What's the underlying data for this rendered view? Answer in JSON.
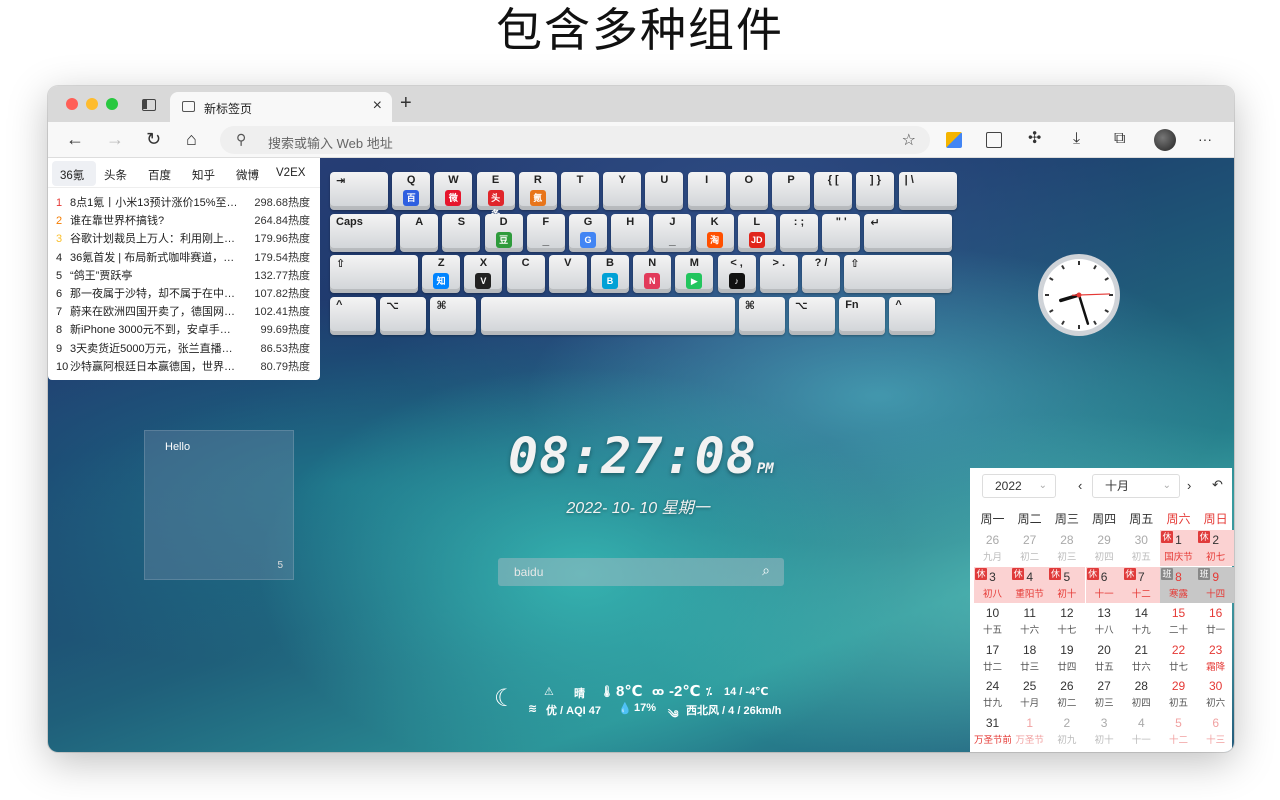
{
  "headline": "包含多种组件",
  "tab": {
    "title": "新标签页",
    "close": "×",
    "new": "+"
  },
  "toolbar": {
    "back": "←",
    "forward": "→",
    "reload": "↻",
    "home": "⌂",
    "search_placeholder": "搜索或输入 Web 地址",
    "more": "···"
  },
  "hot": {
    "tabs": [
      "36氪",
      "头条",
      "百度",
      "知乎",
      "微博",
      "V2EX"
    ],
    "active": "36氪",
    "items": [
      {
        "rank": "1",
        "title": "8点1氪丨小米13预计涨价15%至2…",
        "heat": "298.68热度"
      },
      {
        "rank": "2",
        "title": "谁在靠世界杯搞钱?",
        "heat": "264.84热度"
      },
      {
        "rank": "3",
        "title": "谷歌计划裁员上万人：利用刚上…",
        "heat": "179.96热度"
      },
      {
        "rank": "4",
        "title": "36氪首发 | 布局新式咖啡赛道，…",
        "heat": "179.54热度"
      },
      {
        "rank": "5",
        "title": "“鸽王”贾跃亭",
        "heat": "132.77热度"
      },
      {
        "rank": "6",
        "title": "那一夜属于沙特，却不属于在中…",
        "heat": "107.82热度"
      },
      {
        "rank": "7",
        "title": "蔚来在欧洲四国开卖了，德国网…",
        "heat": "102.41热度"
      },
      {
        "rank": "8",
        "title": "新iPhone 3000元不到，安卓手机…",
        "heat": "99.69热度"
      },
      {
        "rank": "9",
        "title": "3天卖货近5000万元，张兰直播间…",
        "heat": "86.53热度"
      },
      {
        "rank": "10",
        "title": "沙特赢阿根廷日本赢德国，世界杯…",
        "heat": "80.79热度"
      }
    ],
    "rank_colors": [
      "#e53935",
      "#f57c00",
      "#fbc02d"
    ]
  },
  "keyboard": {
    "rows": [
      [
        "⇥",
        "Q",
        "W",
        "E",
        "R",
        "T",
        "Y",
        "U",
        "I",
        "O",
        "P",
        "{ [",
        "] }",
        "| \\"
      ],
      [
        "Caps",
        "A",
        "S",
        "D",
        "F",
        "G",
        "H",
        "J",
        "K",
        "L",
        ": ;",
        "\" '",
        "↵"
      ],
      [
        "⇧",
        "Z",
        "X",
        "C",
        "V",
        "B",
        "N",
        "M",
        "< ,",
        "> .",
        "? /",
        "⇧"
      ],
      [
        "^",
        "⌥",
        "⌘",
        "",
        "⌘",
        "⌥",
        "Fn",
        "^"
      ]
    ],
    "icons": {
      "Q": "baidu-icon",
      "W": "weibo-icon",
      "E": "toutiao-icon",
      "R": "36kr-icon",
      "D": "douban-icon",
      "F": "underscore",
      "G": "google-icon",
      "J": "underscore",
      "K": "taobao-icon",
      "L": "jd-icon",
      "Z": "zhihu-icon",
      "X": "v2ex-icon",
      "B": "bilibili-icon",
      "N": "nn-icon",
      "M": "play-icon",
      "< ,": "tiktok-icon"
    },
    "icon_glyphs": {
      "Q": "百",
      "W": "微",
      "E": "头条",
      "R": "氪",
      "D": "豆",
      "F": "_",
      "G": "G",
      "J": "_",
      "K": "淘",
      "L": "JD",
      "Z": "知",
      "X": "V",
      "B": "B",
      "N": "N",
      "M": "▶",
      "< ,": "♪"
    },
    "icon_colors": {
      "Q": "#2f5fe0",
      "W": "#e6162d",
      "E": "#e0262b",
      "R": "#e8751a",
      "D": "#2e9b3c",
      "G": "#4285f4",
      "K": "#ff5000",
      "L": "#e1251b",
      "Z": "#0084ff",
      "X": "#222222",
      "B": "#00a1d6",
      "N": "#e23a5a",
      "M": "#22c55e",
      "< ,": "#111111"
    }
  },
  "clock": {
    "hour": 8,
    "minute": 27,
    "second": 8
  },
  "memo": {
    "text": "Hello",
    "count": "5"
  },
  "datetime": {
    "time": "08:27:08",
    "ampm": "PM",
    "date": "2022- 10- 10  星期一"
  },
  "search": {
    "value": "baidu",
    "button": "⌕"
  },
  "weather": {
    "moon": "☾",
    "warn": "⚠",
    "condition": "晴",
    "temp": "8℃",
    "feel": "-2℃",
    "range": "14 / -4℃",
    "aqi": "优 / AQI 47",
    "humidity": "17%",
    "wind": "西北风 / 4 / 26km/h"
  },
  "calendar": {
    "year": "2022",
    "month": "十月",
    "prev": "‹",
    "next": "›",
    "back": "↶",
    "weekdays": [
      "周一",
      "周二",
      "周三",
      "周四",
      "周五",
      "周六",
      "周日"
    ],
    "cells": [
      {
        "d": "26",
        "l": "九月",
        "m": "other"
      },
      {
        "d": "27",
        "l": "初二",
        "m": "other"
      },
      {
        "d": "28",
        "l": "初三",
        "m": "other"
      },
      {
        "d": "29",
        "l": "初四",
        "m": "other"
      },
      {
        "d": "30",
        "l": "初五",
        "m": "other"
      },
      {
        "d": "1",
        "l": "国庆节",
        "m": "hol",
        "b": "休"
      },
      {
        "d": "2",
        "l": "初七",
        "m": "hol",
        "b": "休"
      },
      {
        "d": "3",
        "l": "初八",
        "m": "hol",
        "b": "休"
      },
      {
        "d": "4",
        "l": "重阳节",
        "m": "hol",
        "b": "休"
      },
      {
        "d": "5",
        "l": "初十",
        "m": "hol",
        "b": "休"
      },
      {
        "d": "6",
        "l": "十一",
        "m": "hol",
        "b": "休"
      },
      {
        "d": "7",
        "l": "十二",
        "m": "hol",
        "b": "休"
      },
      {
        "d": "8",
        "l": "寒露",
        "m": "work",
        "b": "班"
      },
      {
        "d": "9",
        "l": "十四",
        "m": "work",
        "b": "班"
      },
      {
        "d": "10",
        "l": "十五",
        "m": "cur"
      },
      {
        "d": "11",
        "l": "十六",
        "m": "cur"
      },
      {
        "d": "12",
        "l": "十七",
        "m": "cur"
      },
      {
        "d": "13",
        "l": "十八",
        "m": "cur"
      },
      {
        "d": "14",
        "l": "十九",
        "m": "cur"
      },
      {
        "d": "15",
        "l": "二十",
        "m": "wk"
      },
      {
        "d": "16",
        "l": "廿一",
        "m": "wk"
      },
      {
        "d": "17",
        "l": "廿二",
        "m": "cur"
      },
      {
        "d": "18",
        "l": "廿三",
        "m": "cur"
      },
      {
        "d": "19",
        "l": "廿四",
        "m": "cur"
      },
      {
        "d": "20",
        "l": "廿五",
        "m": "cur"
      },
      {
        "d": "21",
        "l": "廿六",
        "m": "cur"
      },
      {
        "d": "22",
        "l": "廿七",
        "m": "wk"
      },
      {
        "d": "23",
        "l": "霜降",
        "m": "wk"
      },
      {
        "d": "24",
        "l": "廿九",
        "m": "cur"
      },
      {
        "d": "25",
        "l": "十月",
        "m": "cur"
      },
      {
        "d": "26",
        "l": "初二",
        "m": "cur"
      },
      {
        "d": "27",
        "l": "初三",
        "m": "cur"
      },
      {
        "d": "28",
        "l": "初四",
        "m": "cur"
      },
      {
        "d": "29",
        "l": "初五",
        "m": "wk"
      },
      {
        "d": "30",
        "l": "初六",
        "m": "wk"
      },
      {
        "d": "31",
        "l": "万圣节前夜",
        "m": "cur"
      },
      {
        "d": "1",
        "l": "万圣节",
        "m": "otherwk"
      },
      {
        "d": "2",
        "l": "初九",
        "m": "other"
      },
      {
        "d": "3",
        "l": "初十",
        "m": "other"
      },
      {
        "d": "4",
        "l": "十一",
        "m": "other"
      },
      {
        "d": "5",
        "l": "十二",
        "m": "otherwk"
      },
      {
        "d": "6",
        "l": "十三",
        "m": "otherwk"
      }
    ]
  },
  "colors": {
    "accent_red": "#e53935",
    "weekend_red": "#e53935",
    "holiday_bg": "#fbd2d2",
    "work_bg": "#c7c7c7"
  }
}
